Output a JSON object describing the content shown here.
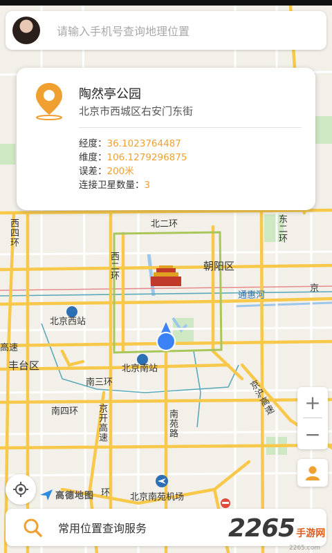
{
  "search": {
    "placeholder": "请输入手机号查询地理位置"
  },
  "location_card": {
    "name": "陶然亭公园",
    "address": "北京市西城区右安门东街",
    "longitude_label": "经度：",
    "longitude_value": "36.1023764487",
    "latitude_label": "维度：",
    "latitude_value": "106.1279296875",
    "error_label": "误差：",
    "error_value": "200米",
    "satellites_label": "连接卫星数量：",
    "satellites_value": "3"
  },
  "map_labels": {
    "xierhuan": "西二环",
    "beierhuan": "北二环",
    "dongerhuan": "东二环",
    "chaoyang": "朝阳区",
    "tonghuihe": "通惠河",
    "beijingxi": "北京西站",
    "beijingnan": "北京南站",
    "fengtai": "丰台区",
    "nansanhuan": "南三环",
    "nansihuan": "南四环",
    "jingkai": "京开高速",
    "nanyuanlu": "南苑路",
    "jinghu": "京沪高速",
    "nanyuan_airport": "北京南苑机场",
    "gaosu": "高速",
    "jing": "京",
    "xisihuan": "西四环",
    "dongsihuan": "东四环",
    "huan": "环"
  },
  "zoom": {
    "in_label": "+",
    "out_label": "−"
  },
  "map_logo": {
    "text": "高德地图"
  },
  "bottom_bar": {
    "label": "常用位置查询服务"
  },
  "watermark": {
    "number": "2265",
    "text": "手游网",
    "domain": "2265.com"
  },
  "colors": {
    "accent": "#f0a030",
    "location_dot": "#3b82f6",
    "road_major": "#f7c84a",
    "road_minor": "#ffffff",
    "rail": "#5aa9b8"
  }
}
